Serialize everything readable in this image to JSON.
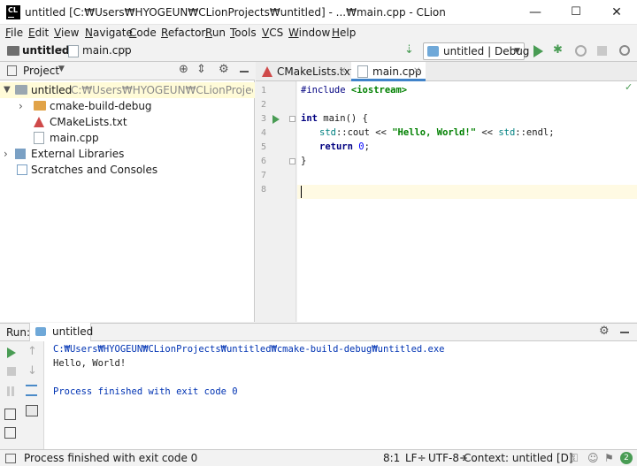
{
  "window": {
    "title": "untitled [C:₩Users₩HYOGEUN₩CLionProjects₩untitled] - ...₩main.cpp - CLion",
    "minimize": "—",
    "maximize": "☐",
    "close": "✕"
  },
  "menubar": [
    "File",
    "Edit",
    "View",
    "Navigate",
    "Code",
    "Refactor",
    "Run",
    "Tools",
    "VCS",
    "Window",
    "Help"
  ],
  "breadcrumb": {
    "project": "untitled",
    "file": "main.cpp"
  },
  "run_config": {
    "label": "untitled | Debug"
  },
  "project_panel": {
    "title": "Project",
    "tree": {
      "root": {
        "label": "untitled",
        "path": "C:₩Users₩HYOGEUN₩CLionProjects₩untitled"
      },
      "build_dir": "cmake-build-debug",
      "cmakelists": "CMakeLists.txt",
      "main_cpp": "main.cpp",
      "external_libraries": "External Libraries",
      "scratches": "Scratches and Consoles"
    }
  },
  "editor": {
    "tabs": [
      "CMakeLists.txt",
      "main.cpp"
    ],
    "line_numbers": [
      "1",
      "2",
      "3",
      "4",
      "5",
      "6",
      "7",
      "8"
    ],
    "code": {
      "l1_kw": "#include ",
      "l1_str": "<iostream>",
      "l3_kw": "int",
      "l3_rest": " main() {",
      "l4_a": "std",
      "l4_b": "::cout << ",
      "l4_str": "\"Hello, World!\"",
      "l4_c": " << ",
      "l4_d": "std",
      "l4_e": "::endl;",
      "l5_kw": "return",
      "l5_sp": " ",
      "l5_num": "0",
      "l5_end": ";",
      "l6": "}"
    }
  },
  "run_panel": {
    "label": "Run:",
    "tab": "untitled",
    "console": [
      "C:₩Users₩HYOGEUN₩CLionProjects₩untitled₩cmake-build-debug₩untitled.exe",
      "Hello, World!",
      "",
      "Process finished with exit code 0"
    ]
  },
  "status": {
    "message": "Process finished with exit code 0",
    "position": "8:1",
    "line_sep": "LF÷",
    "encoding": "UTF-8÷",
    "context": "Context: untitled [D]",
    "notifications": "2"
  },
  "colors": {
    "accent": "#4083c9",
    "run_green": "#499c54",
    "keyword": "#000080",
    "string": "#008000",
    "number": "#0000ff",
    "console_blue": "#0033b3",
    "folder_orange": "#e1a348"
  }
}
